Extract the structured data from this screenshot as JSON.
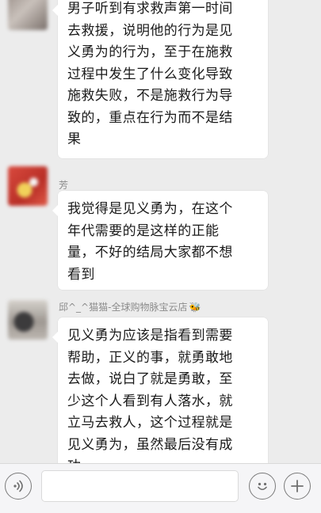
{
  "messages": [
    {
      "sender": "",
      "text": "男子听到有求救声第一时间\n去救援，说明他的行为是见\n义勇为的行为，至于在施救\n过程中发生了什么变化导致\n施救失败，不是施救行为导\n致的，重点在行为而不是结\n果"
    },
    {
      "sender": "芳",
      "text": "我觉得是见义勇为，在这个\n年代需要的是这样的正能\n量，不好的结局大家都不想\n看到"
    },
    {
      "sender": "邱^_^猫猫-全球购物脉宝云店",
      "text": "见义勇为应该是指看到需要\n帮助，正义的事，就勇敢地\n去做，说白了就是勇敢，至\n少这个人看到有人落水，就\n立马去救人，这个过程就是\n见义勇为，虽然最后没有成\n功"
    }
  ],
  "icons": {
    "voice": "voice-icon",
    "emoji": "emoji-icon",
    "plus": "plus-icon",
    "bee": "bee-emoji"
  },
  "colors": {
    "background": "#ececec",
    "bubble": "#ffffff",
    "sender_name": "#8c8c8c",
    "text": "#1a1a1a"
  }
}
